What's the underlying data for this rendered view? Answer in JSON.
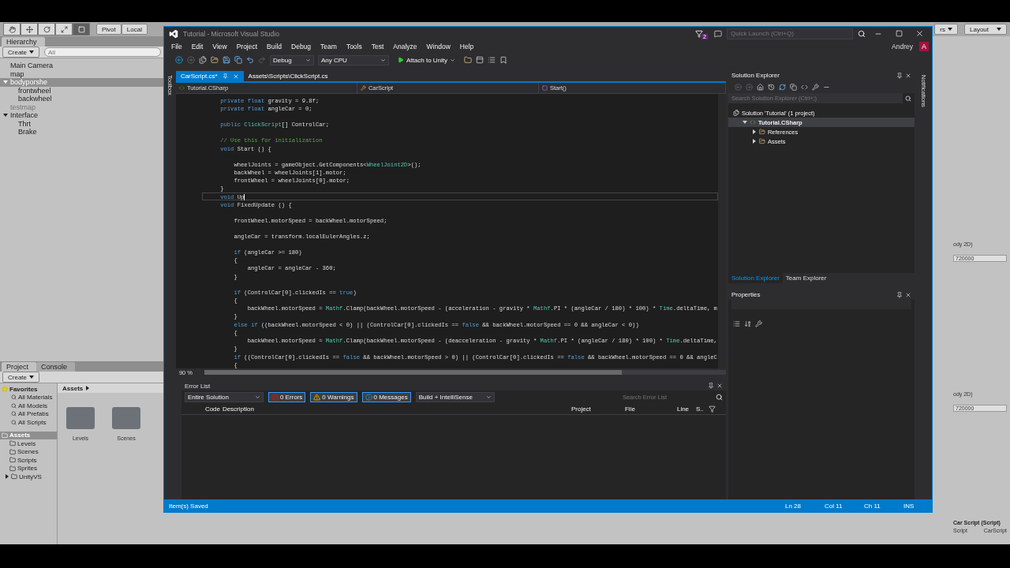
{
  "unity": {
    "tools": [
      {
        "kind": "hand",
        "selected": false
      },
      {
        "kind": "move",
        "selected": false
      },
      {
        "kind": "rotate",
        "selected": false
      },
      {
        "kind": "scale",
        "selected": false
      },
      {
        "kind": "rect",
        "selected": true
      }
    ],
    "pivot": "Pivot",
    "space": "Local",
    "layers": "rs",
    "layout": "Layout",
    "hierarchy": {
      "title": "Hierarchy",
      "create": "Create",
      "search_placeholder": "All",
      "items": [
        {
          "label": "Main Camera",
          "selected": false,
          "inactive": false
        },
        {
          "label": "map",
          "selected": false,
          "inactive": false
        },
        {
          "label": "bodyporshe",
          "selected": true,
          "inactive": false,
          "expanded": true,
          "children": [
            {
              "label": "frontwheel",
              "selected": false,
              "inactive": false
            },
            {
              "label": "backwheel",
              "selected": false,
              "inactive": false
            }
          ]
        },
        {
          "label": "testmap",
          "selected": false,
          "inactive": true
        },
        {
          "label": "Interface",
          "selected": false,
          "inactive": false,
          "expanded": true,
          "children": [
            {
              "label": "Thrt",
              "selected": false,
              "inactive": false
            },
            {
              "label": "Brake",
              "selected": false,
              "inactive": false
            }
          ]
        }
      ]
    },
    "project": {
      "tabs": [
        {
          "label": "Project",
          "selected": true
        },
        {
          "label": "Console",
          "selected": false
        }
      ],
      "create": "Create",
      "favorites": {
        "label": "Favorites",
        "items": [
          "All Materials",
          "All Models",
          "All Prefabs",
          "All Scripts"
        ]
      },
      "assets": {
        "label": "Assets",
        "selected": true,
        "children": [
          {
            "label": "Levels",
            "expandable": false
          },
          {
            "label": "Scenes",
            "expandable": false
          },
          {
            "label": "Scripts",
            "expandable": false
          },
          {
            "label": "Sprites",
            "expandable": false
          },
          {
            "label": "UnityVS",
            "expandable": true
          }
        ]
      },
      "breadcrumb": "Assets",
      "folders": [
        "Levels",
        "Scenes"
      ]
    },
    "inspector": {
      "fields": [
        {
          "label": "ody 2D)",
          "value": "720000"
        },
        {
          "label": "ody 2D)",
          "value": "720000"
        }
      ],
      "component": "Car Script (Script)",
      "script_label": "Script",
      "script_value": "CarScript"
    }
  },
  "vs": {
    "title": "Tutorial - Microsoft Visual Studio",
    "notifications_count": "2",
    "quick_launch": {
      "placeholder": "Quick Launch (Ctrl+Q)"
    },
    "user": "Andrey",
    "avatar": "A",
    "menu": [
      "File",
      "Edit",
      "View",
      "Project",
      "Build",
      "Debug",
      "Team",
      "Tools",
      "Test",
      "Analyze",
      "Window",
      "Help"
    ],
    "toolbar": {
      "configuration": "Debug",
      "platform": "Any CPU",
      "run": "Attach to Unity"
    },
    "toolbox": "Toolbox",
    "notifications": "Notifications",
    "tabs": [
      {
        "label": "CarScript.cs*",
        "selected": true
      },
      {
        "label": "Assets\\Scripts\\ClickScript.cs",
        "selected": false
      }
    ],
    "nav": {
      "project": "Tutorial.CSharp",
      "class": "CarScript",
      "member": "Start()"
    },
    "code": {
      "zoom": "90 %",
      "lines": [
        {
          "kind": "code",
          "current": false,
          "segments": [
            {
              "text": "    private float",
              "kind": "keyword"
            },
            {
              "text": " gravity = 9.8f;",
              "kind": "plain"
            }
          ]
        },
        {
          "kind": "code",
          "current": false,
          "segments": [
            {
              "text": "    private float",
              "kind": "keyword"
            },
            {
              "text": " angleCar = 0;",
              "kind": "plain"
            }
          ]
        },
        {
          "kind": "blank",
          "current": false
        },
        {
          "kind": "code",
          "current": false,
          "segments": [
            {
              "text": "    public ",
              "kind": "keyword"
            },
            {
              "text": "ClickScript",
              "kind": "type"
            },
            {
              "text": "[] ControlCar;",
              "kind": "plain"
            }
          ]
        },
        {
          "kind": "blank",
          "current": false
        },
        {
          "kind": "code",
          "current": false,
          "segments": [
            {
              "text": "    // Use this for initialization",
              "kind": "comment"
            }
          ]
        },
        {
          "kind": "code",
          "current": false,
          "segments": [
            {
              "text": "    void",
              "kind": "keyword"
            },
            {
              "text": " Start () {",
              "kind": "plain"
            }
          ]
        },
        {
          "kind": "blank",
          "current": false
        },
        {
          "kind": "code",
          "current": false,
          "segments": [
            {
              "text": "        wheelJoints = gameObject.GetComponents<",
              "kind": "plain"
            },
            {
              "text": "WheelJoint2D",
              "kind": "type"
            },
            {
              "text": ">();",
              "kind": "plain"
            }
          ]
        },
        {
          "kind": "code",
          "current": false,
          "segments": [
            {
              "text": "        backWheel = wheelJoints[1].motor;",
              "kind": "plain"
            }
          ]
        },
        {
          "kind": "code",
          "current": false,
          "segments": [
            {
              "text": "        frontWheel = wheelJoints[0].motor;",
              "kind": "plain"
            }
          ]
        },
        {
          "kind": "code",
          "current": false,
          "segments": [
            {
              "text": "    }",
              "kind": "plain"
            }
          ]
        },
        {
          "kind": "code",
          "current": true,
          "segments": [
            {
              "text": "    void",
              "kind": "keyword"
            },
            {
              "text": " Up",
              "kind": "plain"
            }
          ]
        },
        {
          "kind": "code",
          "current": false,
          "segments": [
            {
              "text": "    void",
              "kind": "keyword"
            },
            {
              "text": " FixedUpdate () {",
              "kind": "plain"
            }
          ]
        },
        {
          "kind": "blank",
          "current": false
        },
        {
          "kind": "code",
          "current": false,
          "segments": [
            {
              "text": "        frontWheel.motorSpeed = backWheel.motorSpeed;",
              "kind": "plain"
            }
          ]
        },
        {
          "kind": "blank",
          "current": false
        },
        {
          "kind": "code",
          "current": false,
          "segments": [
            {
              "text": "        angleCar = transform.localEulerAngles.z;",
              "kind": "plain"
            }
          ]
        },
        {
          "kind": "blank",
          "current": false
        },
        {
          "kind": "code",
          "current": false,
          "segments": [
            {
              "text": "        if",
              "kind": "keyword"
            },
            {
              "text": " (angleCar >= 180)",
              "kind": "plain"
            }
          ]
        },
        {
          "kind": "code",
          "current": false,
          "segments": [
            {
              "text": "        {",
              "kind": "plain"
            }
          ]
        },
        {
          "kind": "code",
          "current": false,
          "segments": [
            {
              "text": "            angleCar = angleCar - 360;",
              "kind": "plain"
            }
          ]
        },
        {
          "kind": "code",
          "current": false,
          "segments": [
            {
              "text": "        }",
              "kind": "plain"
            }
          ]
        },
        {
          "kind": "blank",
          "current": false
        },
        {
          "kind": "code",
          "current": false,
          "segments": [
            {
              "text": "        if",
              "kind": "keyword"
            },
            {
              "text": " (ControlCar[0].clickedIs == ",
              "kind": "plain"
            },
            {
              "text": "true",
              "kind": "keyword"
            },
            {
              "text": ")",
              "kind": "plain"
            }
          ]
        },
        {
          "kind": "code",
          "current": false,
          "segments": [
            {
              "text": "        {",
              "kind": "plain"
            }
          ]
        },
        {
          "kind": "code",
          "current": false,
          "segments": [
            {
              "text": "            backWheel.motorSpeed = ",
              "kind": "plain"
            },
            {
              "text": "Mathf",
              "kind": "type"
            },
            {
              "text": ".Clamp(backWheel.motorSpeed - (acceleration - gravity * ",
              "kind": "plain"
            },
            {
              "text": "Mathf",
              "kind": "type"
            },
            {
              "text": ".PI * (angleCar / 180) * 100) * ",
              "kind": "plain"
            },
            {
              "text": "Time",
              "kind": "type"
            },
            {
              "text": ".deltaTime, m",
              "kind": "plain"
            }
          ]
        },
        {
          "kind": "code",
          "current": false,
          "segments": [
            {
              "text": "        }",
              "kind": "plain"
            }
          ]
        },
        {
          "kind": "code",
          "current": false,
          "segments": [
            {
              "text": "        else if",
              "kind": "keyword"
            },
            {
              "text": " ((backWheel.motorSpeed < 0) || (ControlCar[0].clickedIs == ",
              "kind": "plain"
            },
            {
              "text": "false",
              "kind": "keyword"
            },
            {
              "text": " && backWheel.motorSpeed == 0 && angleCar < 0))",
              "kind": "plain"
            }
          ]
        },
        {
          "kind": "code",
          "current": false,
          "segments": [
            {
              "text": "        {",
              "kind": "plain"
            }
          ]
        },
        {
          "kind": "code",
          "current": false,
          "segments": [
            {
              "text": "            backWheel.motorSpeed = ",
              "kind": "plain"
            },
            {
              "text": "Mathf",
              "kind": "type"
            },
            {
              "text": ".Clamp(backWheel.motorSpeed - (deacceleration - gravity * ",
              "kind": "plain"
            },
            {
              "text": "Mathf",
              "kind": "type"
            },
            {
              "text": ".PI * (angleCar / 180) * 100) * ",
              "kind": "plain"
            },
            {
              "text": "Time",
              "kind": "type"
            },
            {
              "text": ".deltaTime,",
              "kind": "plain"
            }
          ]
        },
        {
          "kind": "code",
          "current": false,
          "segments": [
            {
              "text": "        }",
              "kind": "plain"
            }
          ]
        },
        {
          "kind": "code",
          "current": false,
          "segments": [
            {
              "text": "        if",
              "kind": "keyword"
            },
            {
              "text": " ((ControlCar[0].clickedIs == ",
              "kind": "plain"
            },
            {
              "text": "false",
              "kind": "keyword"
            },
            {
              "text": " && backWheel.motorSpeed > 0) || (ControlCar[0].clickedIs == ",
              "kind": "plain"
            },
            {
              "text": "false",
              "kind": "keyword"
            },
            {
              "text": " && backWheel.motorSpeed == 0 && angleC",
              "kind": "plain"
            }
          ]
        },
        {
          "kind": "code",
          "current": false,
          "segments": [
            {
              "text": "        {",
              "kind": "plain"
            }
          ]
        }
      ]
    },
    "error_list": {
      "title": "Error List",
      "scope": "Entire Solution",
      "filters": [
        {
          "kind": "error",
          "label": "0 Errors",
          "selected": true
        },
        {
          "kind": "warning",
          "label": "0 Warnings",
          "selected": true
        },
        {
          "kind": "message",
          "label": "0 Messages",
          "selected": true
        }
      ],
      "source": "Build + IntelliSense",
      "search_placeholder": "Search Error List",
      "columns": [
        "Code",
        "Description",
        "Project",
        "File",
        "Line",
        "S.."
      ]
    },
    "solution_explorer": {
      "title": "Solution Explorer",
      "search_placeholder": "Search Solution Explorer (Ctrl+;)",
      "tree": [
        {
          "label": "Solution 'Tutorial' (1 project)",
          "selected": false,
          "children": [
            {
              "label": "Tutorial.CSharp",
              "selected": true,
              "expanded": true,
              "children": [
                {
                  "label": "References",
                  "selected": false,
                  "expanded": false
                },
                {
                  "label": "Assets",
                  "selected": false,
                  "expanded": false
                }
              ]
            }
          ]
        }
      ],
      "tabs": [
        {
          "label": "Solution Explorer",
          "selected": true
        },
        {
          "label": "Team Explorer",
          "selected": false
        }
      ]
    },
    "properties": {
      "title": "Properties"
    },
    "status_bar": {
      "message": "Item(s) Saved",
      "line": "Ln 28",
      "column": "Col 11",
      "char": "Ch 11",
      "mode": "INS"
    }
  }
}
